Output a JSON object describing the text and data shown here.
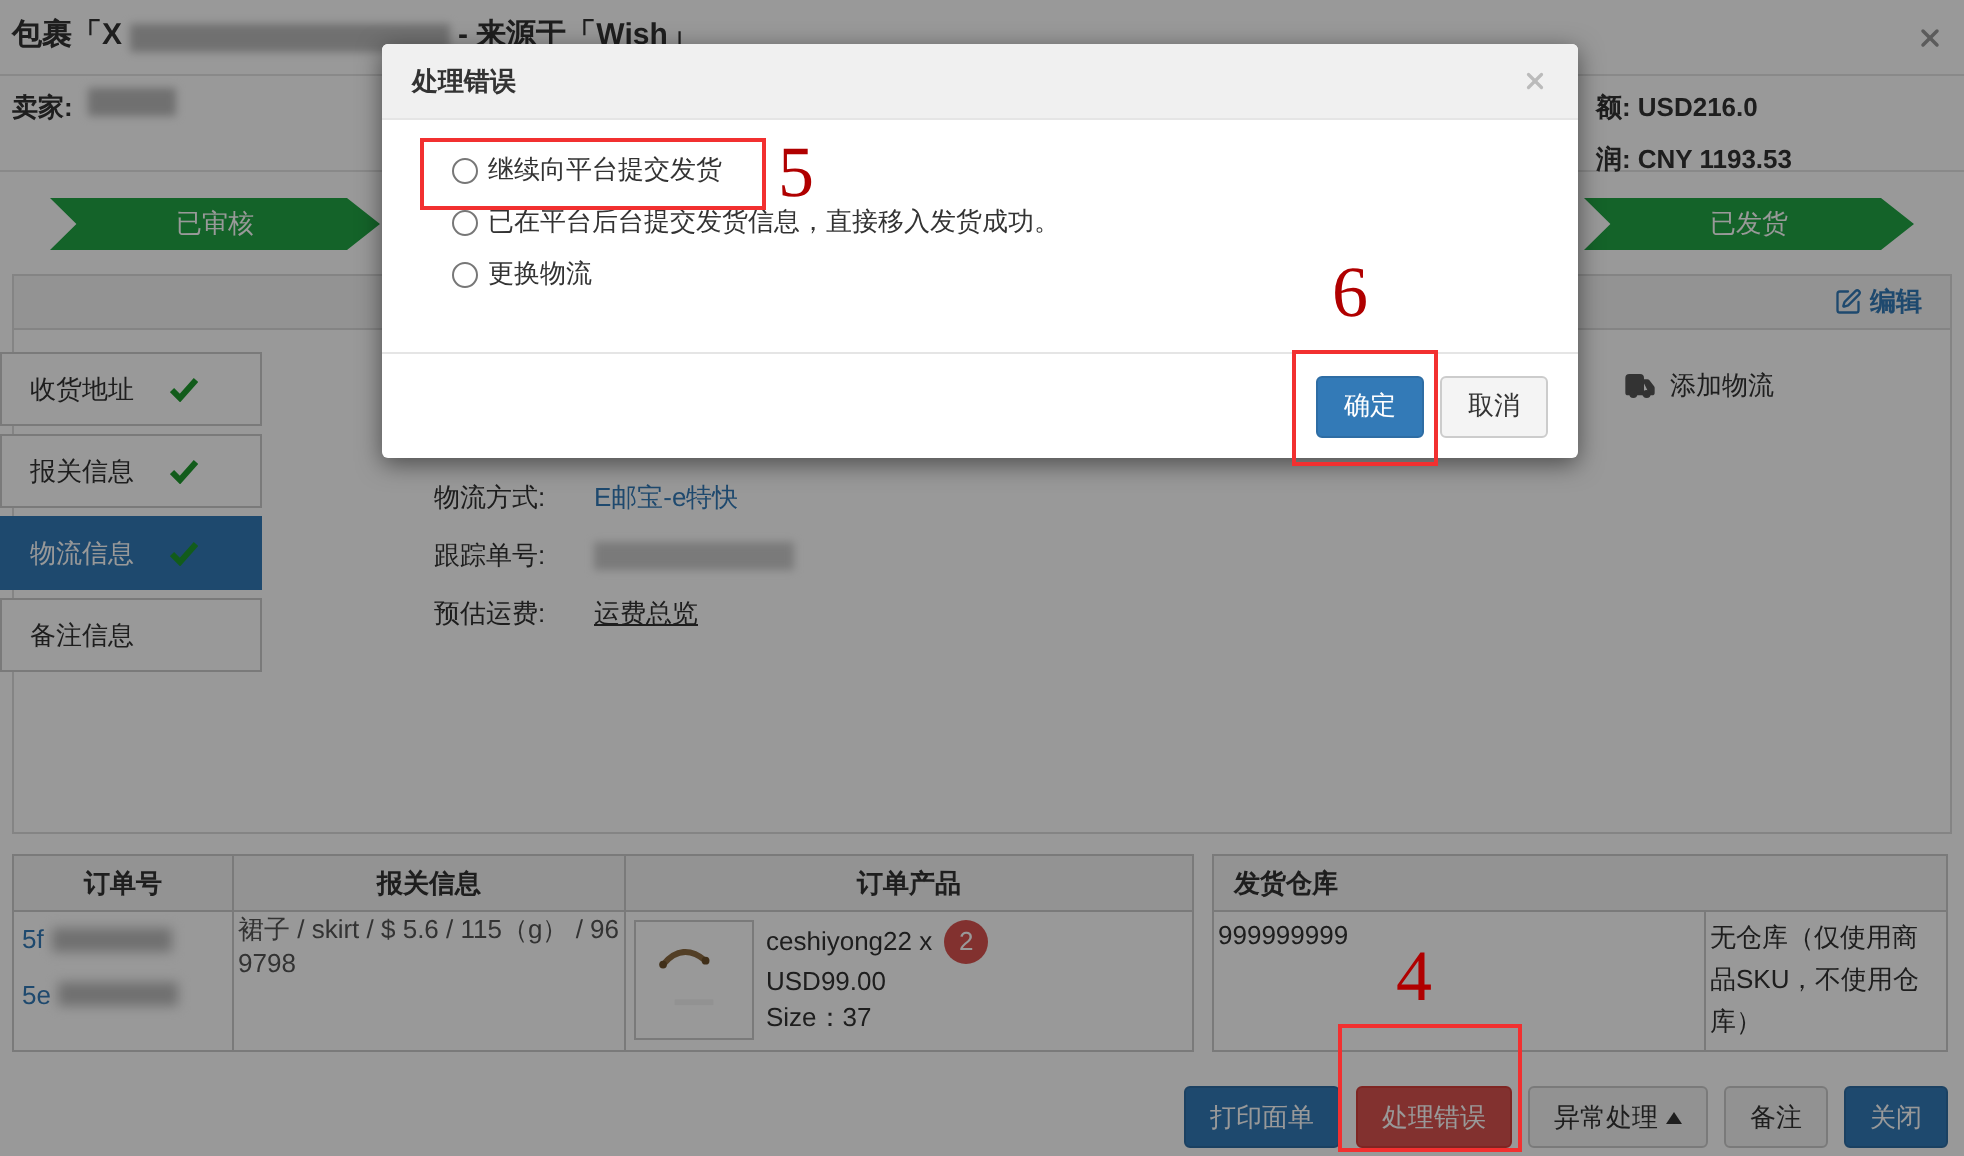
{
  "dialog": {
    "title_start": "包裹「X",
    "title_end": "- 来源于「Wish」",
    "seller_label": "卖家:",
    "total": "额: USD216.0",
    "profit": "润: CNY 1193.53"
  },
  "steps": [
    {
      "label": "已审核"
    },
    {
      "label": "已发货"
    }
  ],
  "panel": {
    "edit": "编辑",
    "add_logistics": "添加物流",
    "tabs": [
      {
        "label": "收货地址",
        "checked": true,
        "selected": false
      },
      {
        "label": "报关信息",
        "checked": true,
        "selected": false
      },
      {
        "label": "物流信息",
        "checked": true,
        "selected": true
      },
      {
        "label": "备注信息",
        "checked": false,
        "selected": false
      }
    ],
    "fields": [
      {
        "label": "物流方式:",
        "value": "E邮宝-e特快",
        "kind": "link"
      },
      {
        "label": "跟踪单号:",
        "kind": "blurred"
      },
      {
        "label": "预估运费:",
        "value": "运费总览",
        "kind": "underline"
      }
    ]
  },
  "orders": {
    "columns": [
      "订单号",
      "报关信息",
      "订单产品"
    ],
    "order_numbers": [
      "5f",
      "5e"
    ],
    "customs": "裙子 / skirt / $ 5.6 / 115（g） / 969798",
    "product": {
      "name": "ceshiyong22 x",
      "quantity": "2",
      "price": "USD99.00",
      "size": "Size：37"
    }
  },
  "warehouse": {
    "column": "发货仓库",
    "code": "999999999",
    "note": "无仓库（仅使用商品SKU，不使用仓库）"
  },
  "actions": [
    {
      "label": "打印面单",
      "kind": "primary"
    },
    {
      "label": "处理错误",
      "kind": "danger"
    },
    {
      "label": "异常处理",
      "kind": "dropdown"
    },
    {
      "label": "备注",
      "kind": "default"
    },
    {
      "label": "关闭",
      "kind": "primary"
    }
  ],
  "modal": {
    "title": "处理错误",
    "options": [
      {
        "label": "继续向平台提交发货",
        "selected": false
      },
      {
        "label": "已在平台后台提交发货信息，直接移入发货成功。",
        "selected": false
      },
      {
        "label": "更换物流",
        "selected": false
      }
    ],
    "buttons": [
      {
        "label": "确定",
        "kind": "primary"
      },
      {
        "label": "取消",
        "kind": "default"
      }
    ]
  },
  "annotations": [
    {
      "label": "5"
    },
    {
      "label": "6"
    },
    {
      "label": "4"
    }
  ]
}
